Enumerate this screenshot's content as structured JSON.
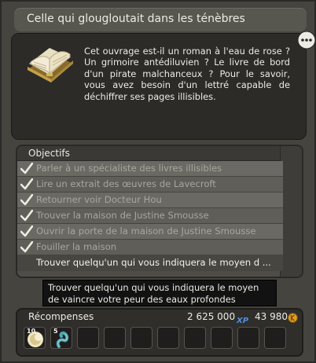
{
  "window": {
    "title": "Celle qui glougloutait dans les ténèbres"
  },
  "description": "Cet ouvrage est-il un roman à l'eau de rose ? Un grimoire antédiluvien ? Le livre de bord d'un pirate malchanceux ? Pour le savoir, vous avez besoin d'un lettré capable de déchiffrer ses pages illisibles.",
  "icons": {
    "quest": "open-book-icon",
    "chat": "speech-bubble-icon",
    "check": "checkmark-icon",
    "xp": "xp-icon",
    "kama": "kama-coin-icon"
  },
  "objectives": {
    "header": "Objectifs",
    "items": [
      {
        "label": "Parler à un spécialiste des livres illisibles",
        "done": true
      },
      {
        "label": "Lire un extrait des œuvres de Lavecroft",
        "done": true
      },
      {
        "label": "Retourner voir Docteur Hou",
        "done": true
      },
      {
        "label": "Trouver la maison de Justine Smousse",
        "done": true
      },
      {
        "label": "Ouvrir la porte de la maison de Justine Smousse",
        "done": true
      },
      {
        "label": "Fouiller la maison",
        "done": true
      },
      {
        "label": "Trouver quelqu'un qui vous indiquera le moyen d ...",
        "done": false
      }
    ]
  },
  "tooltip": "Trouver quelqu'un qui vous indiquera le moyen de vaincre votre peur des eaux profondes",
  "rewards": {
    "label": "Récompenses",
    "xp": "2 625 000",
    "xp_icon_text": "XP",
    "kamas": "43 980",
    "items": [
      {
        "count": "10",
        "icon": "moon-resource-icon"
      },
      {
        "count": "5",
        "icon": "tentacle-resource-icon"
      }
    ],
    "empty_slots": 8
  },
  "colors": {
    "accent_xp": "#4d8fe0",
    "kama": "#e0a024",
    "check": "#e8e8e2"
  }
}
